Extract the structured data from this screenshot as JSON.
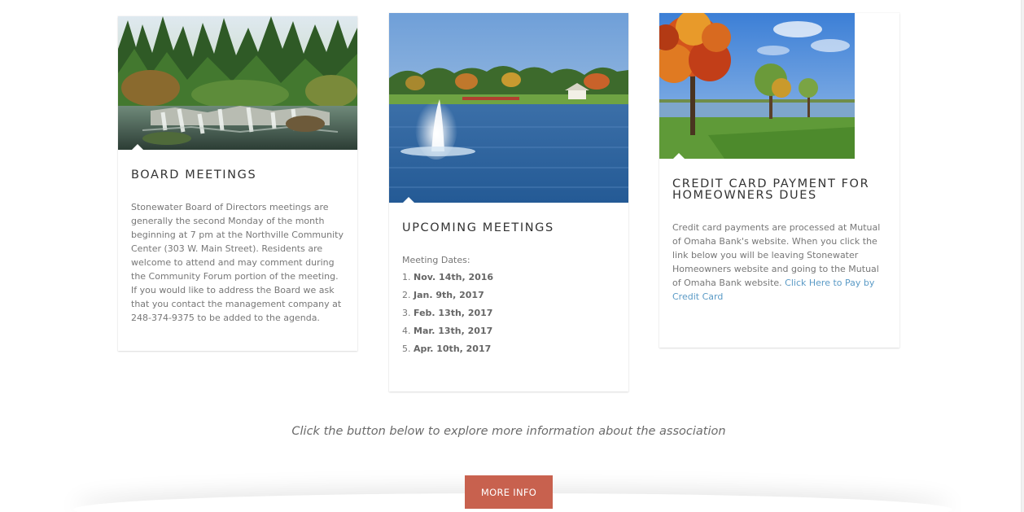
{
  "cards": [
    {
      "title": "BOARD MEETINGS",
      "body": "Stonewater Board of Directors meetings are generally the second Monday of the month beginning at 7 pm at the Northville Community Center (303 W. Main Street). Residents are welcome to attend and may comment during the Community Forum portion of the meeting.  If you would like to address the Board we ask that you contact the management company at 248-374-9375 to be added to the agenda.",
      "image": "waterfall-landscape"
    },
    {
      "title": "UPCOMING MEETINGS",
      "intro": "Meeting Dates:",
      "meetings": [
        {
          "num": "1.",
          "date": "Nov. 14th, 2016"
        },
        {
          "num": "2.",
          "date": "Jan. 9th, 2017"
        },
        {
          "num": "3.",
          "date": "Feb. 13th, 2017"
        },
        {
          "num": "4.",
          "date": "Mar. 13th, 2017"
        },
        {
          "num": "5.",
          "date": "Apr. 10th, 2017"
        }
      ],
      "image": "lake-fountain"
    },
    {
      "title": "CREDIT CARD PAYMENT FOR HOMEOWNERS DUES",
      "body": "Credit card payments are processed at Mutual of Omaha Bank's website. When you click the link below you will be leaving Stonewater Homeowners website and going to the Mutual of Omaha Bank website.",
      "link_text": "Click Here to Pay by Credit Card",
      "image": "autumn-tree-pond"
    }
  ],
  "cta_text": "Click the button below to explore more information about the association",
  "button_label": "MORE INFO",
  "colors": {
    "button": "#c8614e",
    "link": "#5a9ac6",
    "title": "#333333",
    "body_text": "#777777"
  }
}
